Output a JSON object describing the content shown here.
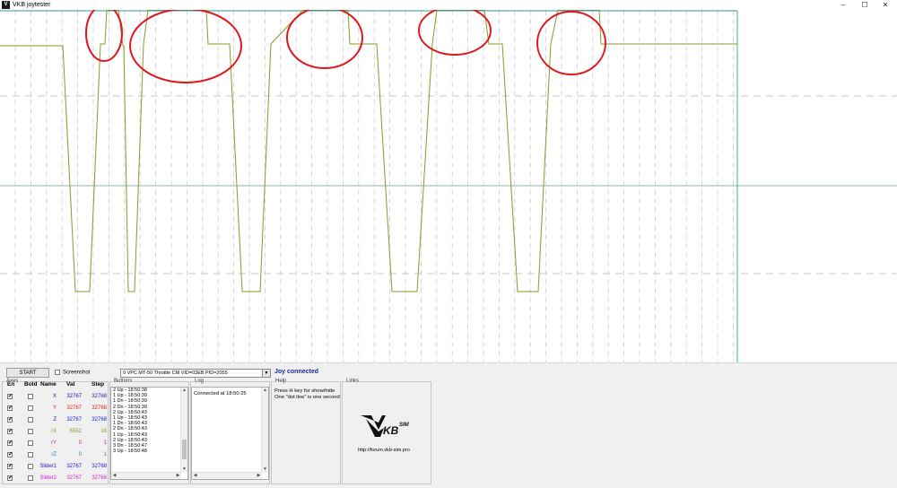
{
  "window": {
    "title": "VKB joytester",
    "icon_glyph": "V",
    "controls": {
      "minimize": "–",
      "maximize": "☐",
      "close": "✕"
    }
  },
  "graph": {
    "description_colors": {
      "trace": "#8a9a2a",
      "frame": "#3cb371",
      "top_frame": "#2f9aa0",
      "annotation": "#e0191f",
      "grid": "#c8c8c8",
      "center_line": "#9aaeb0"
    }
  },
  "toolbar": {
    "start_label": "START",
    "screenshot_label": "Screenshot",
    "screenshot_checked": false,
    "device_value": "0 VPC MT-50 Throttle CM VID=03EB PID=2055",
    "dropdown_arrow": "▼",
    "status_text": "Joy connected",
    "status_color": "#1a2b9c"
  },
  "axes": {
    "group_title": "Axes",
    "headers": {
      "en": "En",
      "bold": "Bold",
      "name": "Name",
      "val": "Val",
      "step": "Step"
    },
    "rows": [
      {
        "enabled": true,
        "bold": false,
        "name": "X",
        "val": "32767",
        "step": "32768",
        "color": "#1a1aa6"
      },
      {
        "enabled": true,
        "bold": false,
        "name": "Y",
        "val": "32767",
        "step": "32768",
        "color": "#e02020"
      },
      {
        "enabled": true,
        "bold": false,
        "name": "Z",
        "val": "32767",
        "step": "32768",
        "color": "#1a1acc"
      },
      {
        "enabled": true,
        "bold": false,
        "name": "rX",
        "val": "6552",
        "step": "16",
        "color": "#8a9a2a"
      },
      {
        "enabled": true,
        "bold": false,
        "name": "rY",
        "val": "0",
        "step": "1",
        "color": "#c020a0"
      },
      {
        "enabled": true,
        "bold": false,
        "name": "rZ",
        "val": "0",
        "step": "1",
        "color": "#1a7ad0"
      },
      {
        "enabled": true,
        "bold": false,
        "name": "Slider1",
        "val": "32767",
        "step": "32768",
        "color": "#1a1acc"
      },
      {
        "enabled": true,
        "bold": false,
        "name": "Slider2",
        "val": "32767",
        "step": "32768",
        "color": "#d020d0"
      }
    ]
  },
  "buttons_panel": {
    "title": "Buttons",
    "items": [
      "2 Up - 18:50:38",
      "1 Up - 18:50:39",
      "1 Dn - 18:50:39",
      "2 Dn - 18:50:39",
      "2 Up - 18:50:43",
      "1 Up - 18:50:43",
      "1 Dn - 18:50:43",
      "2 Dn - 18:50:43",
      "1 Up - 18:50:43",
      "2 Up - 18:50:43",
      "3 Dn - 18:50:47",
      "3 Up - 18:50:48"
    ]
  },
  "log_panel": {
    "title": "Log",
    "items": [
      "Connected at 18:50:25"
    ]
  },
  "help_panel": {
    "title": "Help",
    "lines": [
      "Press H key for show/hide",
      "One \"dot line\" is one second"
    ]
  },
  "links_panel": {
    "title": "Links",
    "logo_text": "KBSIM",
    "url": "http://forum.vkb-sim.pro"
  }
}
